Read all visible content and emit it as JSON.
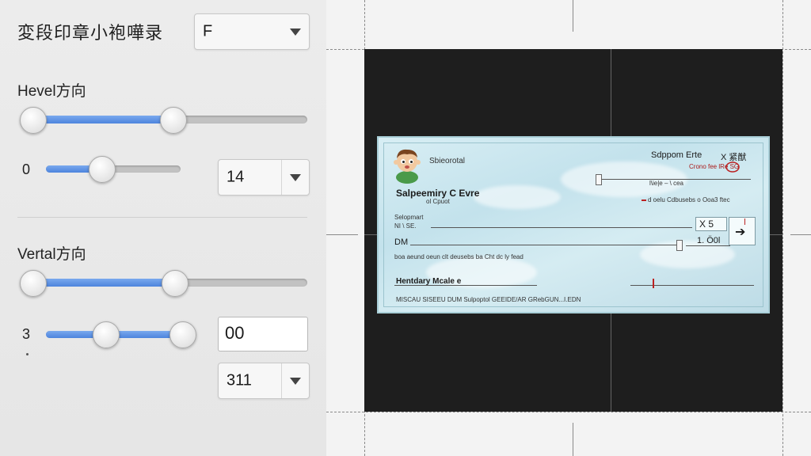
{
  "panel": {
    "title": "変段印章小袍嘩录",
    "top_select": {
      "value": "F"
    },
    "horizontal": {
      "label": "Hevel方向",
      "slider_value": 0.5,
      "sub_label": "0",
      "sub_slider_value": 0.4,
      "select_value": "14"
    },
    "vertical": {
      "label": "Vertal方向",
      "slider_value": 0.5,
      "sub_label": "3",
      "range_low": 0.45,
      "range_high": 1.0,
      "input_value": "00",
      "select_value": "311"
    }
  },
  "check": {
    "company_name": "Salpeemiry C Evre",
    "company_sub": "ol Cpuot",
    "mascot_caption": "Sbieorotal",
    "bank_name": "Sdppom Erte",
    "top_right_code": "X 紧猷",
    "account_line": "Crono fee lRe  SG",
    "date_label": "l\\ie|e  – \\ cea",
    "small_line": "d oelu  Cdbusebs o Ooa3 ftec",
    "pay_to_label": "Selopmart",
    "pay_sub": "NI \\ SE.",
    "dm_label": "DM",
    "amount_box": "X 5",
    "amount_small": "1. Ö0l",
    "words_line": "boa aeund  oeun clt deusebs ba Cht dc ly fead",
    "signature_label": "Hentdary Mcale e",
    "micr_line": "MISCAU  SISEEU DUM  Sulpoptol GEEIDE/AR GRebGUN...I.EDN"
  }
}
